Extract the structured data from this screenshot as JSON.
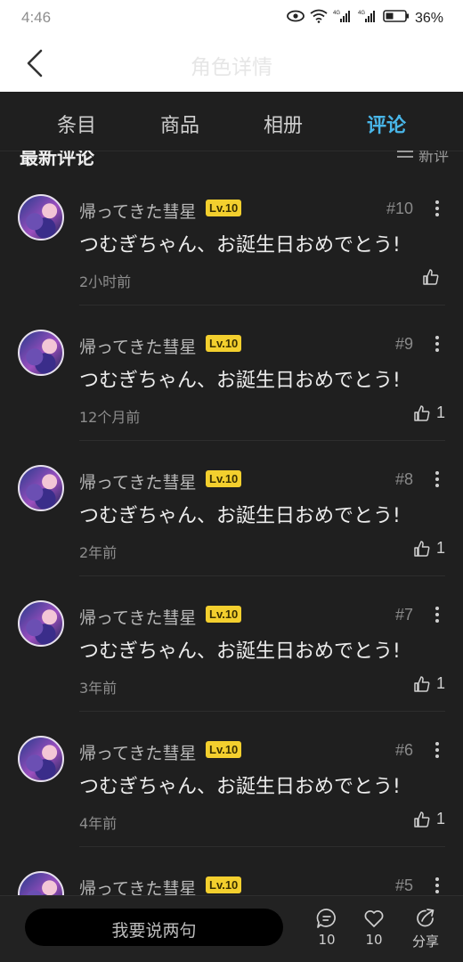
{
  "status_bar": {
    "time": "4:46",
    "battery": "36%"
  },
  "header": {
    "title": "角色详情"
  },
  "tabs": [
    "条目",
    "商品",
    "相册",
    "评论"
  ],
  "section": {
    "title": "最新评论",
    "sort_label": "新评"
  },
  "comments": [
    {
      "user": "帰ってきた彗星",
      "level": "Lv.10",
      "floor": "#10",
      "text": "つむぎちゃん、お誕生日おめでとう!",
      "time": "2小时前",
      "likes": ""
    },
    {
      "user": "帰ってきた彗星",
      "level": "Lv.10",
      "floor": "#9",
      "text": "つむぎちゃん、お誕生日おめでとう!",
      "time": "12个月前",
      "likes": "1"
    },
    {
      "user": "帰ってきた彗星",
      "level": "Lv.10",
      "floor": "#8",
      "text": "つむぎちゃん、お誕生日おめでとう!",
      "time": "2年前",
      "likes": "1"
    },
    {
      "user": "帰ってきた彗星",
      "level": "Lv.10",
      "floor": "#7",
      "text": "つむぎちゃん、お誕生日おめでとう!",
      "time": "3年前",
      "likes": "1"
    },
    {
      "user": "帰ってきた彗星",
      "level": "Lv.10",
      "floor": "#6",
      "text": "つむぎちゃん、お誕生日おめでとう!",
      "time": "4年前",
      "likes": "1"
    },
    {
      "user": "帰ってきた彗星",
      "level": "Lv.10",
      "floor": "#5",
      "text": "",
      "time": "",
      "likes": ""
    }
  ],
  "bottom_bar": {
    "input_placeholder": "我要说两句",
    "comment_count": "10",
    "like_count": "10",
    "share_label": "分享"
  }
}
